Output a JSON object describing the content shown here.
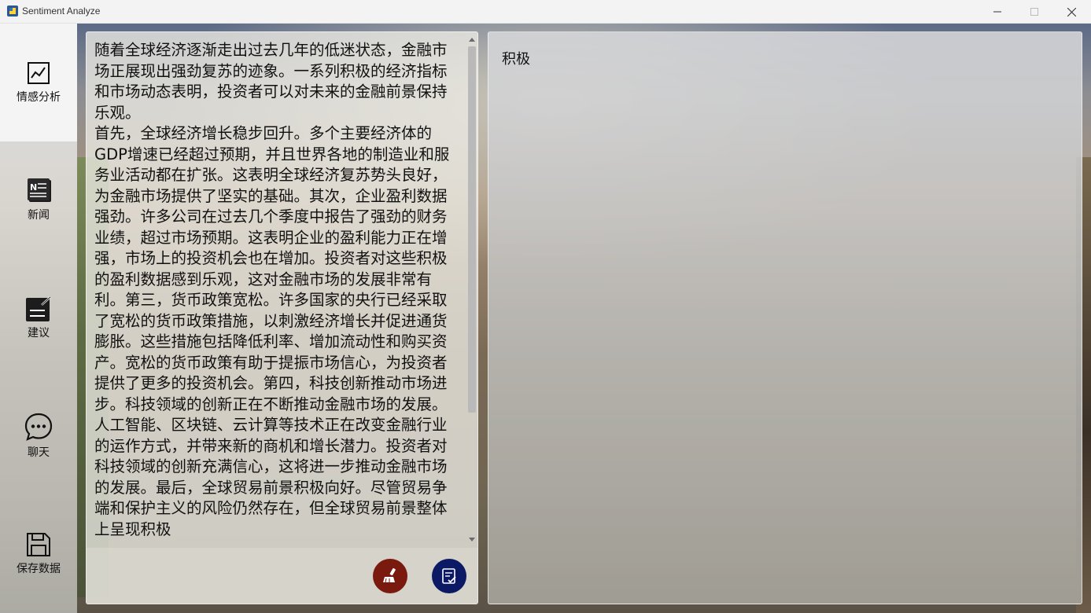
{
  "window": {
    "title": "Sentiment Analyze"
  },
  "sidebar": {
    "items": [
      {
        "label": "情感分析",
        "icon": "chart-line-icon",
        "active": true
      },
      {
        "label": "新闻",
        "icon": "news-icon",
        "active": false
      },
      {
        "label": "建议",
        "icon": "note-edit-icon",
        "active": false
      },
      {
        "label": "聊天",
        "icon": "chat-bubble-icon",
        "active": false
      },
      {
        "label": "保存数据",
        "icon": "save-icon",
        "active": false
      }
    ]
  },
  "input": {
    "text": "随着全球经济逐渐走出过去几年的低迷状态，金融市场正展现出强劲复苏的迹象。一系列积极的经济指标和市场动态表明，投资者可以对未来的金融前景保持乐观。\n首先，全球经济增长稳步回升。多个主要经济体的GDP增速已经超过预期，并且世界各地的制造业和服务业活动都在扩张。这表明全球经济复苏势头良好，为金融市场提供了坚实的基础。其次，企业盈利数据强劲。许多公司在过去几个季度中报告了强劲的财务业绩，超过市场预期。这表明企业的盈利能力正在增强，市场上的投资机会也在增加。投资者对这些积极的盈利数据感到乐观，这对金融市场的发展非常有利。第三，货币政策宽松。许多国家的央行已经采取了宽松的货币政策措施，以刺激经济增长并促进通货膨胀。这些措施包括降低利率、增加流动性和购买资产。宽松的货币政策有助于提振市场信心，为投资者提供了更多的投资机会。第四，科技创新推动市场进步。科技领域的创新正在不断推动金融市场的发展。人工智能、区块链、云计算等技术正在改变金融行业的运作方式，并带来新的商机和增长潜力。投资者对科技领域的创新充满信心，这将进一步推动金融市场的发展。最后，全球贸易前景积极向好。尽管贸易争端和保护主义的风险仍然存在，但全球贸易前景整体上呈现积极"
  },
  "actions": {
    "clear_icon": "broom-icon",
    "analyze_icon": "document-check-icon",
    "clear_color": "#7a1a0e",
    "analyze_color": "#0c1a66"
  },
  "result": {
    "sentiment": "积极"
  }
}
